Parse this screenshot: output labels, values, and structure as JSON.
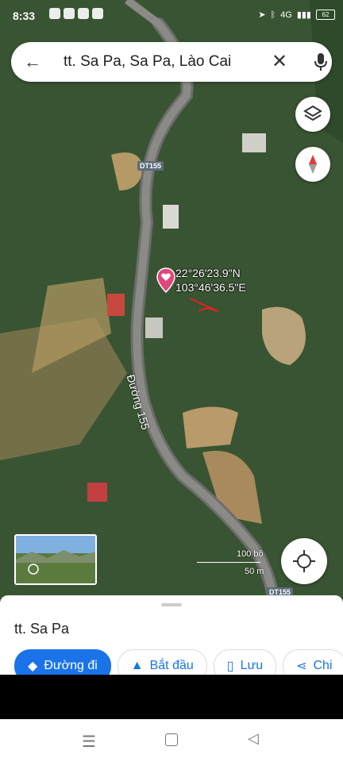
{
  "status": {
    "time": "8:33",
    "network": "4G",
    "battery": "62"
  },
  "search": {
    "query": "tt. Sa Pa, Sa Pa, Lào Cai"
  },
  "map": {
    "coordinates_lat": "22°26'23.9\"N",
    "coordinates_lng": "103°46'36.5\"E",
    "road_label_top": "DT155",
    "road_label_bottom": "DT155",
    "road_name": "Đường 155",
    "scale_ft": "100 bộ",
    "scale_m": "50 m"
  },
  "sheet": {
    "place": "tt. Sa Pa",
    "actions": [
      {
        "label": "Đường đi"
      },
      {
        "label": "Bắt đầu"
      },
      {
        "label": "Lưu"
      },
      {
        "label": "Chi"
      }
    ]
  }
}
